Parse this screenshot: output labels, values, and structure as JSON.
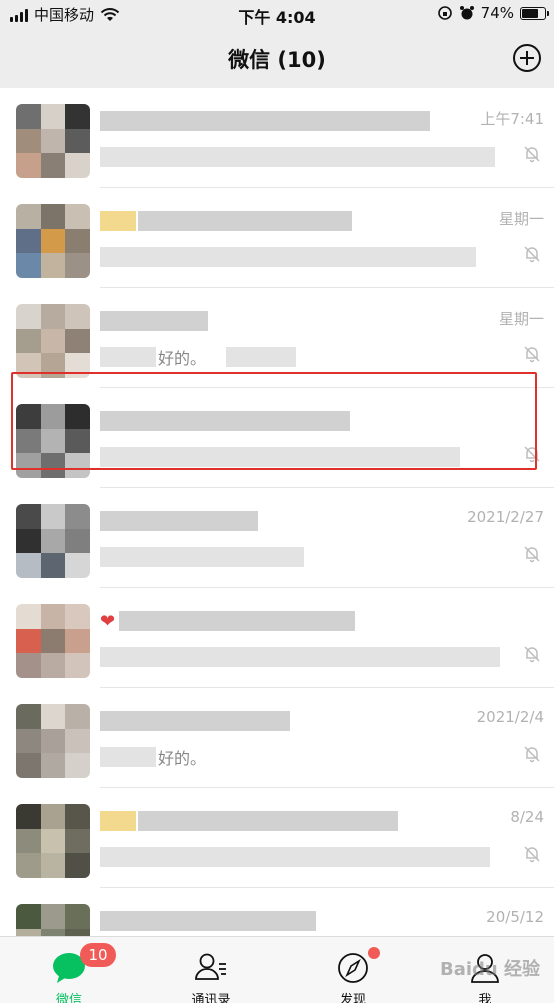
{
  "status_bar": {
    "carrier": "中国移动",
    "time": "下午 4:04",
    "battery": "74%",
    "battery_level": 0.74
  },
  "header": {
    "title": "微信 (10)",
    "add_icon": "plus-circle-icon"
  },
  "chats": [
    {
      "time": "上午7:41",
      "name": "",
      "message": "",
      "muted": true
    },
    {
      "time": "星期一",
      "name": "",
      "message": "",
      "muted": true
    },
    {
      "time": "星期一",
      "name": "",
      "message": "好的。",
      "muted": true
    },
    {
      "time": "",
      "name": "",
      "message": "",
      "muted": true
    },
    {
      "time": "2021/2/27",
      "name": "",
      "message": "",
      "muted": true
    },
    {
      "time": "",
      "name": "",
      "message": "",
      "muted": true
    },
    {
      "time": "2021/2/4",
      "name": "",
      "message": "好的。",
      "muted": true
    },
    {
      "time": "8/24",
      "name": "",
      "message": "",
      "muted": true
    },
    {
      "time": "20/5/12",
      "name": "",
      "message": "",
      "muted": false
    }
  ],
  "tabs": [
    {
      "label": "微信",
      "icon": "chat-bubble-icon",
      "active": true,
      "badge": "10"
    },
    {
      "label": "通讯录",
      "icon": "contacts-icon",
      "active": false
    },
    {
      "label": "发现",
      "icon": "compass-icon",
      "active": false,
      "dot": true
    },
    {
      "label": "我",
      "icon": "person-icon",
      "active": false
    }
  ],
  "colors": {
    "accent": "#07c160",
    "badge": "#f15b57",
    "highlight": "#e0302c",
    "background": "#ededed"
  },
  "watermark": "Baidu 经验"
}
